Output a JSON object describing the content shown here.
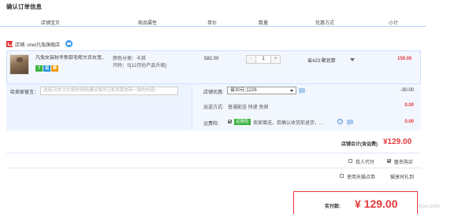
{
  "section_title": "确认订单信息",
  "columns": [
    "店铺宝贝",
    "商品属性",
    "单价",
    "数量",
    "优惠方式",
    "小计"
  ],
  "shop": {
    "label": "店铺: onet凡兔旗舰店"
  },
  "item": {
    "title": "凡兔女装秋冬新款毛呢大衣女宽...",
    "service_badges": [
      "7",
      "运",
      "券"
    ],
    "props": [
      "颜色分类：卡其",
      "尺码：S[12月份产品升级]"
    ],
    "price": "582.00",
    "quantity": "1",
    "minus": "-",
    "plus": "+",
    "promotion": "省423:聚划算",
    "subtotal": "159.00"
  },
  "message": {
    "label": "给卖家留言：",
    "placeholder": "选填:对本次交易的说明(建议填写已和卖家协商一致的内容)"
  },
  "coupon": {
    "label": "店铺优惠:",
    "selected": "省30元:1226",
    "amount": "-30.00"
  },
  "shipping": {
    "label": "运送方式:",
    "desc": "普通配送 快递 免邮",
    "amount": "0.00"
  },
  "insurance": {
    "label": "运费险:",
    "tag": "运费险",
    "desc": "卖家赠送，若确认收货前退货，...",
    "amount": "0.00",
    "help": "?"
  },
  "store_total": {
    "label": "店铺合计(含运费)",
    "amount": "¥129.00"
  },
  "options": {
    "proxy_pay": "我人代付",
    "anonymous": "匿名购买",
    "use_tmall_points": "使用天猫点券",
    "points_note": "猫享时礼到"
  },
  "final": {
    "label": "实付款:",
    "amount": "¥ 129.00"
  },
  "watermark": "ikoo.com",
  "colors": {
    "accent": "#e4393c",
    "header_border": "#b2d1ff",
    "item_bg": "#f2f7ff",
    "insurance_tag": "#3cb340"
  }
}
